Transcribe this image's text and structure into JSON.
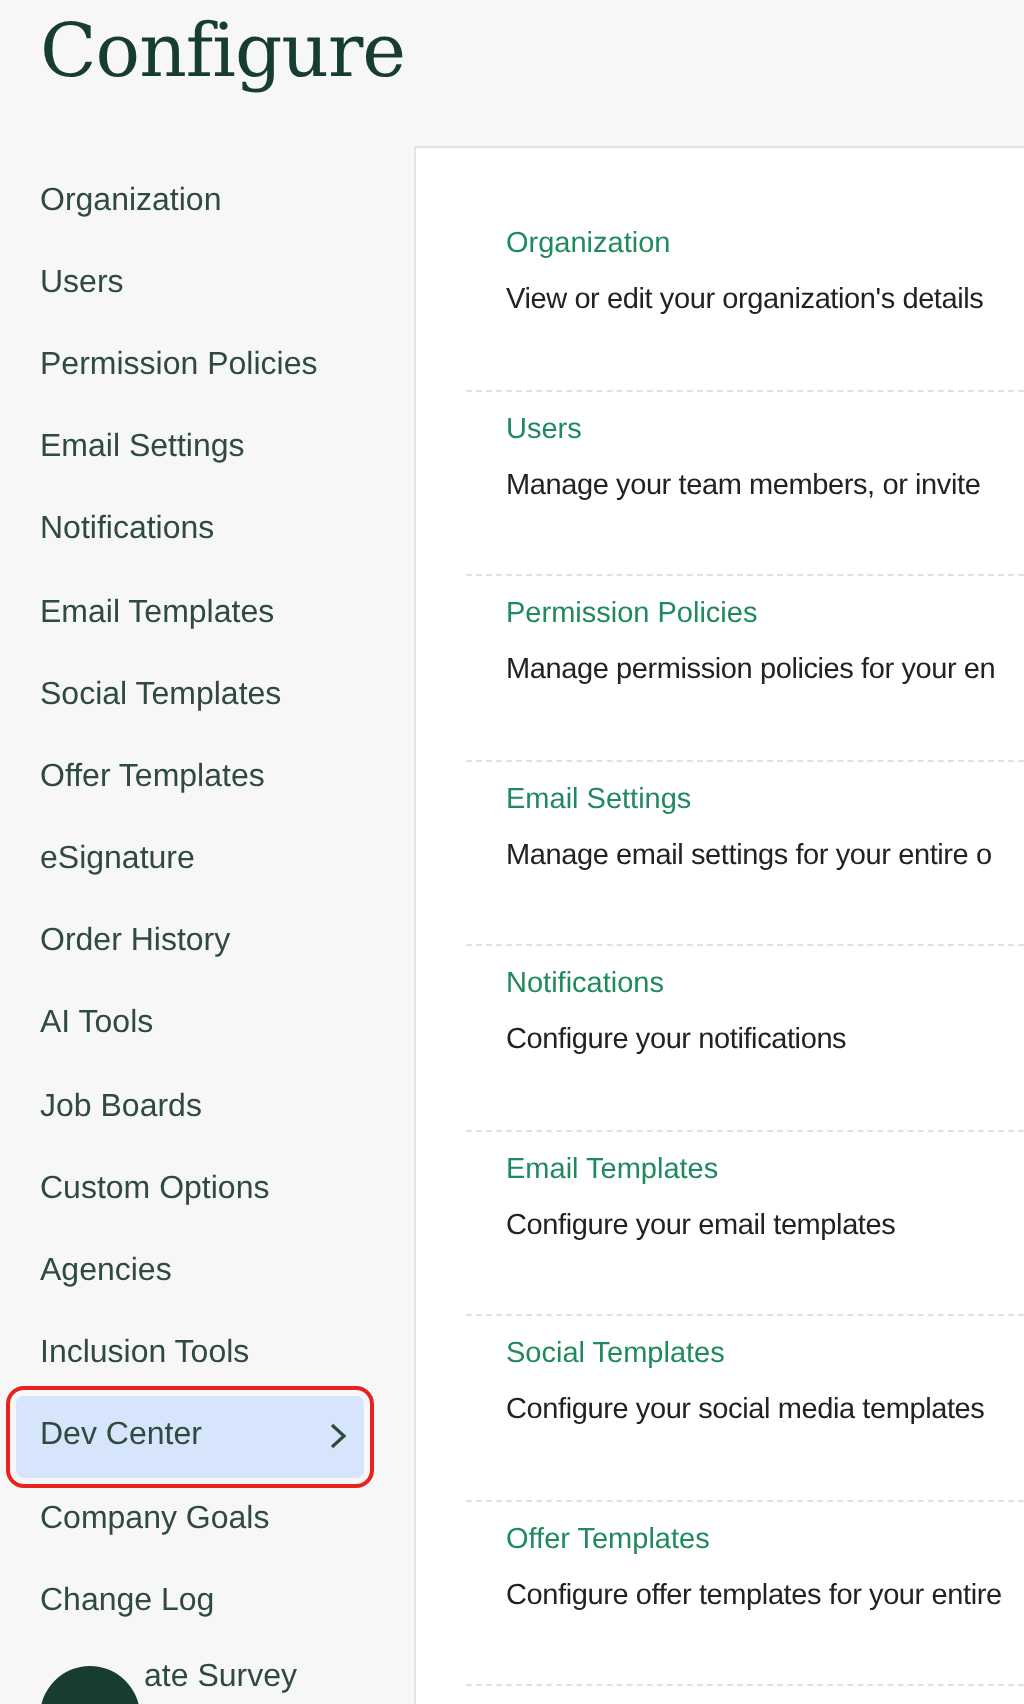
{
  "title": "Configure",
  "sidebar": {
    "items": [
      {
        "label": "Organization",
        "selected": false
      },
      {
        "label": "Users",
        "selected": false
      },
      {
        "label": "Permission Policies",
        "selected": false
      },
      {
        "label": "Email Settings",
        "selected": false
      },
      {
        "label": "Notifications",
        "selected": false
      },
      {
        "label": "Email Templates",
        "selected": false
      },
      {
        "label": "Social Templates",
        "selected": false
      },
      {
        "label": "Offer Templates",
        "selected": false
      },
      {
        "label": "eSignature",
        "selected": false
      },
      {
        "label": "Order History",
        "selected": false
      },
      {
        "label": "AI Tools",
        "selected": false
      },
      {
        "label": "Job Boards",
        "selected": false
      },
      {
        "label": "Custom Options",
        "selected": false
      },
      {
        "label": "Agencies",
        "selected": false
      },
      {
        "label": "Inclusion Tools",
        "selected": false
      },
      {
        "label": "Dev Center",
        "selected": true,
        "annotated": true
      },
      {
        "label": "Company Goals",
        "selected": false
      },
      {
        "label": "Change Log",
        "selected": false
      },
      {
        "label": "ate Survey",
        "selected": false,
        "covered": true
      }
    ]
  },
  "sections": [
    {
      "title": "Organization",
      "description": "View or edit your organization's details"
    },
    {
      "title": "Users",
      "description": "Manage your team members, or invite"
    },
    {
      "title": "Permission Policies",
      "description": "Manage permission policies for your en"
    },
    {
      "title": "Email Settings",
      "description": "Manage email settings for your entire o"
    },
    {
      "title": "Notifications",
      "description": "Configure your notifications"
    },
    {
      "title": "Email Templates",
      "description": "Configure your email templates"
    },
    {
      "title": "Social Templates",
      "description": "Configure your social media templates"
    },
    {
      "title": "Offer Templates",
      "description": "Configure offer templates for your entire"
    }
  ]
}
